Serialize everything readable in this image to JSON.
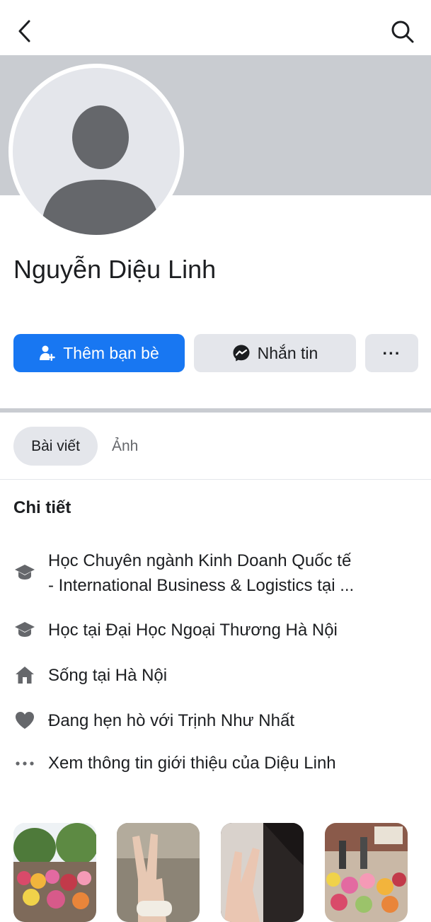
{
  "header": {
    "back_icon": "chevron-left-icon",
    "search_icon": "search-icon"
  },
  "profile": {
    "name": "Nguyễn Diệu Linh",
    "avatar": "default-avatar-icon"
  },
  "actions": {
    "add_friend_label": "Thêm bạn bè",
    "add_friend_icon": "person-add-icon",
    "message_label": "Nhắn tin",
    "message_icon": "messenger-icon",
    "more_label": "···"
  },
  "tabs": [
    {
      "label": "Bài viết",
      "active": true
    },
    {
      "label": "Ảnh",
      "active": false
    }
  ],
  "details": {
    "title": "Chi tiết",
    "items": [
      {
        "icon": "graduation-cap-icon",
        "line1": "Học Chuyên ngành Kinh Doanh Quốc tế",
        "line2": "- International Business & Logistics tại ..."
      },
      {
        "icon": "graduation-cap-icon",
        "prefix": "Học tại ",
        "bold": "Đại Học Ngoại Thương Hà Nội"
      },
      {
        "icon": "house-icon",
        "prefix": "Sống tại ",
        "bold": "Hà Nội"
      },
      {
        "icon": "heart-icon",
        "prefix": "Đang hẹn hò với ",
        "bold": "Trịnh Như Nhất"
      },
      {
        "icon": "more-dots-icon",
        "text": "Xem thông tin giới thiệu của Diệu Linh"
      }
    ]
  },
  "photos": [
    {
      "subject": "flower-market"
    },
    {
      "subject": "hand-peace-sign"
    },
    {
      "subject": "hand-peace-sign-dark"
    },
    {
      "subject": "flower-shop"
    }
  ],
  "colors": {
    "primary": "#1877f2",
    "button_gray": "#e4e6eb",
    "cover_gray": "#c9ccd1",
    "text": "#1c1e21",
    "secondary_text": "#65676b",
    "icon_gray": "#65676b"
  }
}
